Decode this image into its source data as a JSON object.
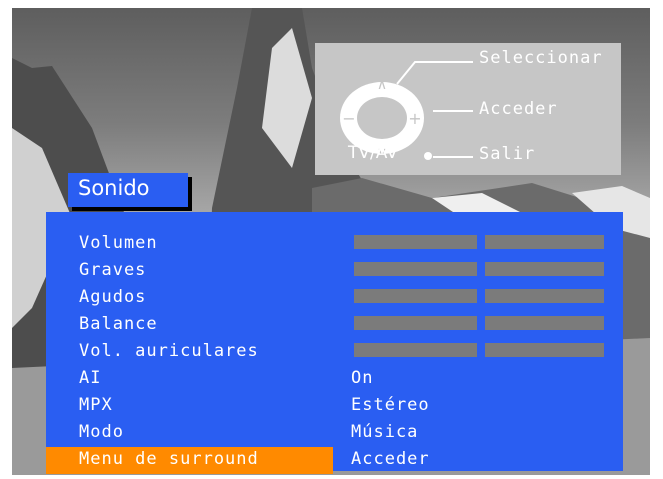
{
  "legend": {
    "select_label": "Seleccionar",
    "enter_label": "Acceder",
    "exit_label": "Salir",
    "tvav_label": "TV/AV"
  },
  "menu": {
    "title": "Sonido",
    "items": [
      {
        "label": "Volumen",
        "type": "slider"
      },
      {
        "label": "Graves",
        "type": "slider"
      },
      {
        "label": "Agudos",
        "type": "slider"
      },
      {
        "label": "Balance",
        "type": "slider"
      },
      {
        "label": "Vol. auriculares",
        "type": "slider"
      },
      {
        "label": "AI",
        "type": "value",
        "value": "On"
      },
      {
        "label": "MPX",
        "type": "value",
        "value": "Estéreo"
      },
      {
        "label": "Modo",
        "type": "value",
        "value": "Música"
      },
      {
        "label": "Menu de surround",
        "type": "value",
        "value": "Acceder",
        "selected": true
      }
    ]
  },
  "colors": {
    "panel": "#2a5ef2",
    "highlight": "#ff8a00",
    "bar": "#7b7b7b",
    "legend_bg": "#c6c6c6"
  }
}
